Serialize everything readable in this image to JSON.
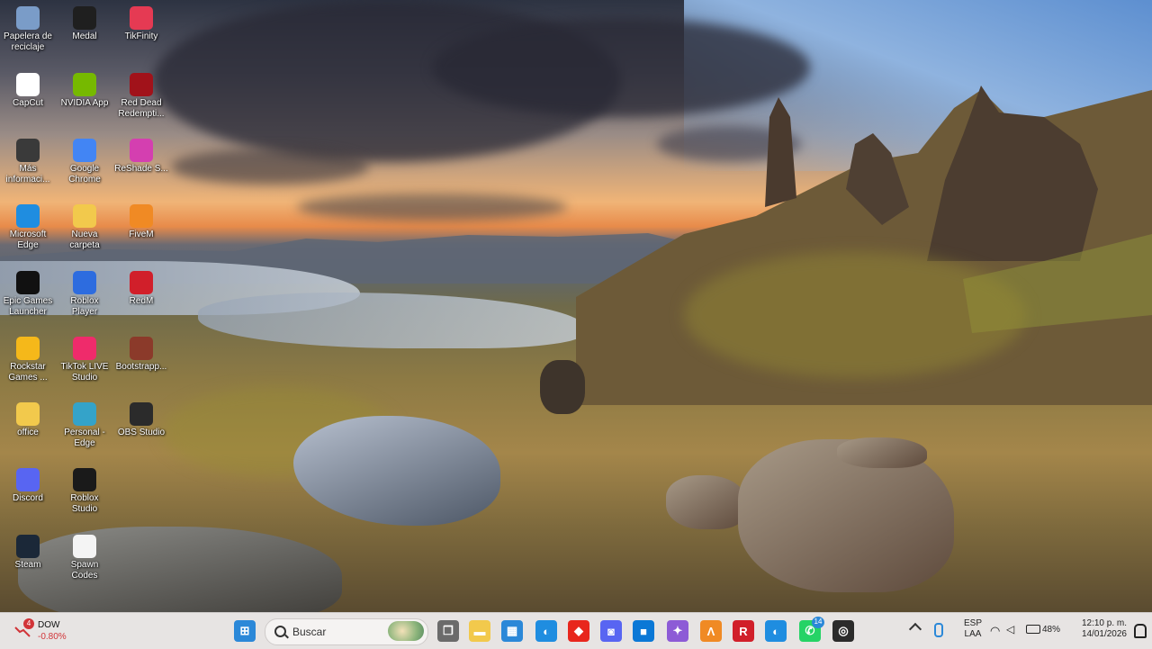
{
  "desktop_icons": [
    {
      "label": "Papelera de reciclaje",
      "icon": "recycle-bin-icon",
      "color": "#7a9cc8"
    },
    {
      "label": "Medal",
      "icon": "medal-icon",
      "color": "#1f1f1f"
    },
    {
      "label": "TikFinity",
      "icon": "tikfinity-icon",
      "color": "#e53a53"
    },
    {
      "label": "CapCut",
      "icon": "capcut-icon",
      "color": "#ffffff"
    },
    {
      "label": "NVIDIA App",
      "icon": "nvidia-icon",
      "color": "#76b900"
    },
    {
      "label": "Red Dead Redempti...",
      "icon": "red-dead-icon",
      "color": "#a1121a"
    },
    {
      "label": "Más informaci...",
      "icon": "info-icon",
      "color": "#3a3a3a"
    },
    {
      "label": "Google Chrome",
      "icon": "chrome-icon",
      "color": "#4285f4"
    },
    {
      "label": "ReShade S...",
      "icon": "reshade-icon",
      "color": "#d43fb0"
    },
    {
      "label": "Microsoft Edge",
      "icon": "edge-icon",
      "color": "#1f8de0"
    },
    {
      "label": "Nueva carpeta",
      "icon": "folder-icon",
      "color": "#f2c94c"
    },
    {
      "label": "FiveM",
      "icon": "fivem-icon",
      "color": "#f08a24"
    },
    {
      "label": "Epic Games Launcher",
      "icon": "epic-games-icon",
      "color": "#111111"
    },
    {
      "label": "Roblox Player",
      "icon": "roblox-player-icon",
      "color": "#2d6cdf"
    },
    {
      "label": "RedM",
      "icon": "redm-icon",
      "color": "#d11f2a"
    },
    {
      "label": "Rockstar Games ...",
      "icon": "rockstar-icon",
      "color": "#f5b81a"
    },
    {
      "label": "TikTok LIVE Studio",
      "icon": "tiktok-live-icon",
      "color": "#ef2b6b"
    },
    {
      "label": "Bootstrapp...",
      "icon": "bootstrapper-icon",
      "color": "#8b3a2a"
    },
    {
      "label": "office",
      "icon": "office-folder-icon",
      "color": "#f2c94c"
    },
    {
      "label": "Personal - Edge",
      "icon": "edge-personal-icon",
      "color": "#34a3c9"
    },
    {
      "label": "OBS Studio",
      "icon": "obs-icon",
      "color": "#2b2b2b"
    },
    {
      "label": "Discord",
      "icon": "discord-icon",
      "color": "#5865f2"
    },
    {
      "label": "Roblox Studio",
      "icon": "roblox-studio-icon",
      "color": "#1a1a1a"
    },
    {
      "label": "Steam",
      "icon": "steam-icon",
      "color": "#1b2838"
    },
    {
      "label": "Spawn Codes",
      "icon": "text-file-icon",
      "color": "#f4f4f4"
    }
  ],
  "taskbar": {
    "stock": {
      "name": "DOW",
      "change": "-0.80%",
      "badge": "4",
      "change_color": "#d13438"
    },
    "search_placeholder": "Buscar",
    "apps": [
      {
        "name": "start-button",
        "icon": "windows-icon",
        "color": "#2b88d8",
        "glyph": "⊞"
      },
      {
        "name": "taskview-button",
        "icon": "task-view-icon",
        "color": "#6b6b6b",
        "glyph": "❐"
      },
      {
        "name": "file-explorer-button",
        "icon": "folder-icon",
        "color": "#f2c94c",
        "glyph": "▬"
      },
      {
        "name": "store-button",
        "icon": "store-icon",
        "color": "#2b88d8",
        "glyph": "▦"
      },
      {
        "name": "edge-dev-button",
        "icon": "edge-icon",
        "color": "#1f8de0",
        "glyph": "◐"
      },
      {
        "name": "app-red-button",
        "icon": "diamond-icon",
        "color": "#e8261c",
        "glyph": "◆"
      },
      {
        "name": "discord-button",
        "icon": "discord-icon",
        "color": "#5865f2",
        "glyph": "◙"
      },
      {
        "name": "app-blue-button",
        "icon": "window-icon",
        "color": "#0b78d6",
        "glyph": "■"
      },
      {
        "name": "copilot-button",
        "icon": "copilot-icon",
        "color": "#8d5bd6",
        "glyph": "✦"
      },
      {
        "name": "fivem-button",
        "icon": "fivem-icon",
        "color": "#f08a24",
        "glyph": "Λ"
      },
      {
        "name": "redm-button",
        "icon": "redm-icon",
        "color": "#d11f2a",
        "glyph": "R"
      },
      {
        "name": "edge-button",
        "icon": "edge-icon",
        "color": "#1f8de0",
        "glyph": "◐"
      },
      {
        "name": "whatsapp-button",
        "icon": "whatsapp-icon",
        "color": "#25d366",
        "glyph": "✆"
      },
      {
        "name": "obs-button",
        "icon": "obs-icon",
        "color": "#2b2b2b",
        "glyph": "◎"
      }
    ],
    "whatsapp_badge": "14",
    "tray": {
      "language": "ESP",
      "layout": "LAA",
      "battery": "48%",
      "time": "12:10 p. m.",
      "date": "14/01/2026"
    }
  }
}
